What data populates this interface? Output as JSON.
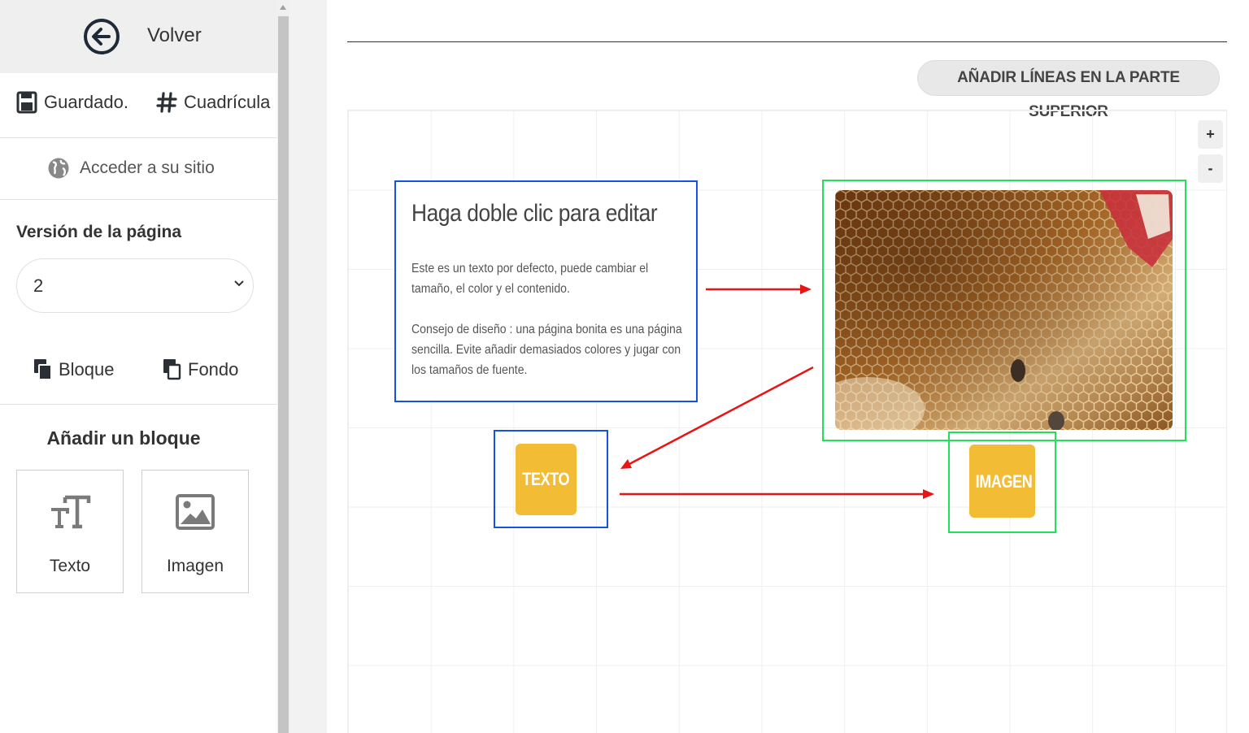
{
  "sidebar": {
    "back_label": "Volver",
    "saved_label": "Guardado.",
    "grid_label": "Cuadrícula",
    "site_label": "Acceder a su sitio",
    "version_title": "Versión de la página",
    "version_value": "2",
    "block_label": "Bloque",
    "background_label": "Fondo",
    "add_block_title": "Añadir un bloque",
    "add_items": [
      {
        "label": "Texto",
        "icon": "text-size-icon"
      },
      {
        "label": "Imagen",
        "icon": "image-icon"
      }
    ]
  },
  "canvas": {
    "add_lines_button": "AÑADIR LÍNEAS EN LA PARTE SUPERIOR",
    "zoom_in": "+",
    "zoom_out": "-",
    "text_block": {
      "title": "Haga doble clic para editar",
      "paragraph_1": "Este es un texto por defecto, puede cambiar el tamaño, el color y el contenido.",
      "paragraph_2": "Consejo de diseño : una página bonita es una página sencilla. Evite añadir demasiados colores y jugar con los tamaños de fuente."
    },
    "texto_button": "TEXTO",
    "imagen_button": "IMAGEN"
  },
  "colors": {
    "accent_yellow": "#f2bd35",
    "text_outline_blue": "#1553e6",
    "image_outline_green": "#22e05a",
    "arrow_red": "#e81515"
  }
}
